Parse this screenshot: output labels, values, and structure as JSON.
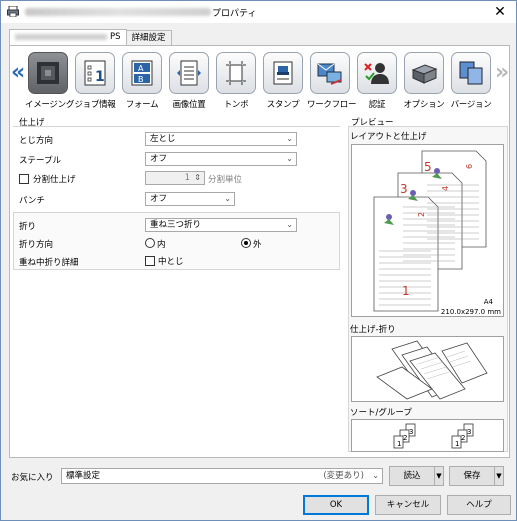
{
  "window": {
    "title_suffix": "プロパティ",
    "close_glyph": "✕"
  },
  "tabs": [
    {
      "label": "PS"
    },
    {
      "label": "詳細設定"
    }
  ],
  "toolbar": {
    "left_arrow": "«",
    "right_arrow": "»",
    "items": [
      {
        "label": "イメージング"
      },
      {
        "label": "ジョブ情報"
      },
      {
        "label": "フォーム"
      },
      {
        "label": "画像位置"
      },
      {
        "label": "トンボ"
      },
      {
        "label": "スタンプ"
      },
      {
        "label": "ワークフロー"
      },
      {
        "label": "認証"
      },
      {
        "label": "オプション"
      },
      {
        "label": "バージョン"
      }
    ]
  },
  "finishing": {
    "group_label": "仕上げ",
    "binding_label": "とじ方向",
    "binding_value": "左とじ",
    "staple_label": "ステープル",
    "staple_value": "オフ",
    "split_label": "分割仕上げ",
    "split_value": "1",
    "split_unit": "分割単位",
    "punch_label": "パンチ",
    "punch_value": "オフ",
    "fold_label": "折り",
    "fold_value": "重ね三つ折り",
    "fold_dir_label": "折り方向",
    "fold_in": "内",
    "fold_out": "外",
    "fold_detail_label": "重ね中折り詳細",
    "center_staple": "中とじ"
  },
  "preview": {
    "group_label": "プレビュー",
    "layout_label": "レイアウトと仕上げ",
    "paper": "A4",
    "paper_size": "210.0x297.0 mm",
    "fold_label": "仕上げ-折り",
    "sort_label": "ソート/グループ",
    "page_numbers": [
      "1",
      "2",
      "3",
      "4",
      "5",
      "6"
    ]
  },
  "favorites": {
    "label": "お気に入り",
    "value": "標準設定",
    "changed": "(変更あり)",
    "load": "読込",
    "save": "保存"
  },
  "buttons": {
    "ok": "OK",
    "cancel": "キャンセル",
    "help": "ヘルプ"
  }
}
